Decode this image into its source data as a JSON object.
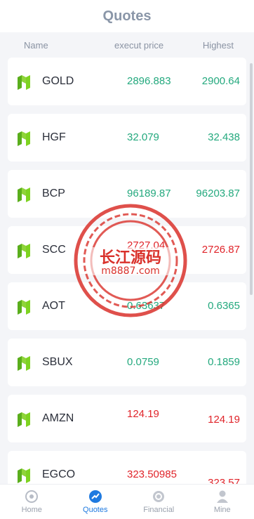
{
  "header": {
    "title": "Quotes"
  },
  "columns": {
    "name": "Name",
    "price": "execut price",
    "highest": "Highest"
  },
  "rows": [
    {
      "name": "GOLD",
      "price": "2896.883",
      "highest": "2900.64",
      "trend": "up"
    },
    {
      "name": "HGF",
      "price": "32.079",
      "highest": "32.438",
      "trend": "up"
    },
    {
      "name": "BCP",
      "price": "96189.87",
      "highest": "96203.87",
      "trend": "up"
    },
    {
      "name": "SCC",
      "price": "2727.04",
      "highest": "2726.87",
      "trend": "down"
    },
    {
      "name": "AOT",
      "price": "0.63637",
      "highest": "0.6365",
      "trend": "up"
    },
    {
      "name": "SBUX",
      "price": "0.0759",
      "highest": "0.1859",
      "trend": "up"
    },
    {
      "name": "AMZN",
      "price": "124.19",
      "highest": "124.19",
      "trend": "down"
    },
    {
      "name": "EGCO",
      "price": "323.50985",
      "highest": "323.57",
      "trend": "down"
    }
  ],
  "watermark": {
    "line1": "长江源码",
    "line2": "m8887.com"
  },
  "tabs": [
    {
      "label": "Home",
      "icon": "home-icon"
    },
    {
      "label": "Quotes",
      "icon": "quotes-icon",
      "active": true
    },
    {
      "label": "Financial",
      "icon": "financial-icon"
    },
    {
      "label": "Mine",
      "icon": "user-icon"
    }
  ],
  "colors": {
    "up": "#24a97e",
    "down": "#e0242a",
    "accent": "#1f7ae0",
    "logo": "#7ed321"
  }
}
